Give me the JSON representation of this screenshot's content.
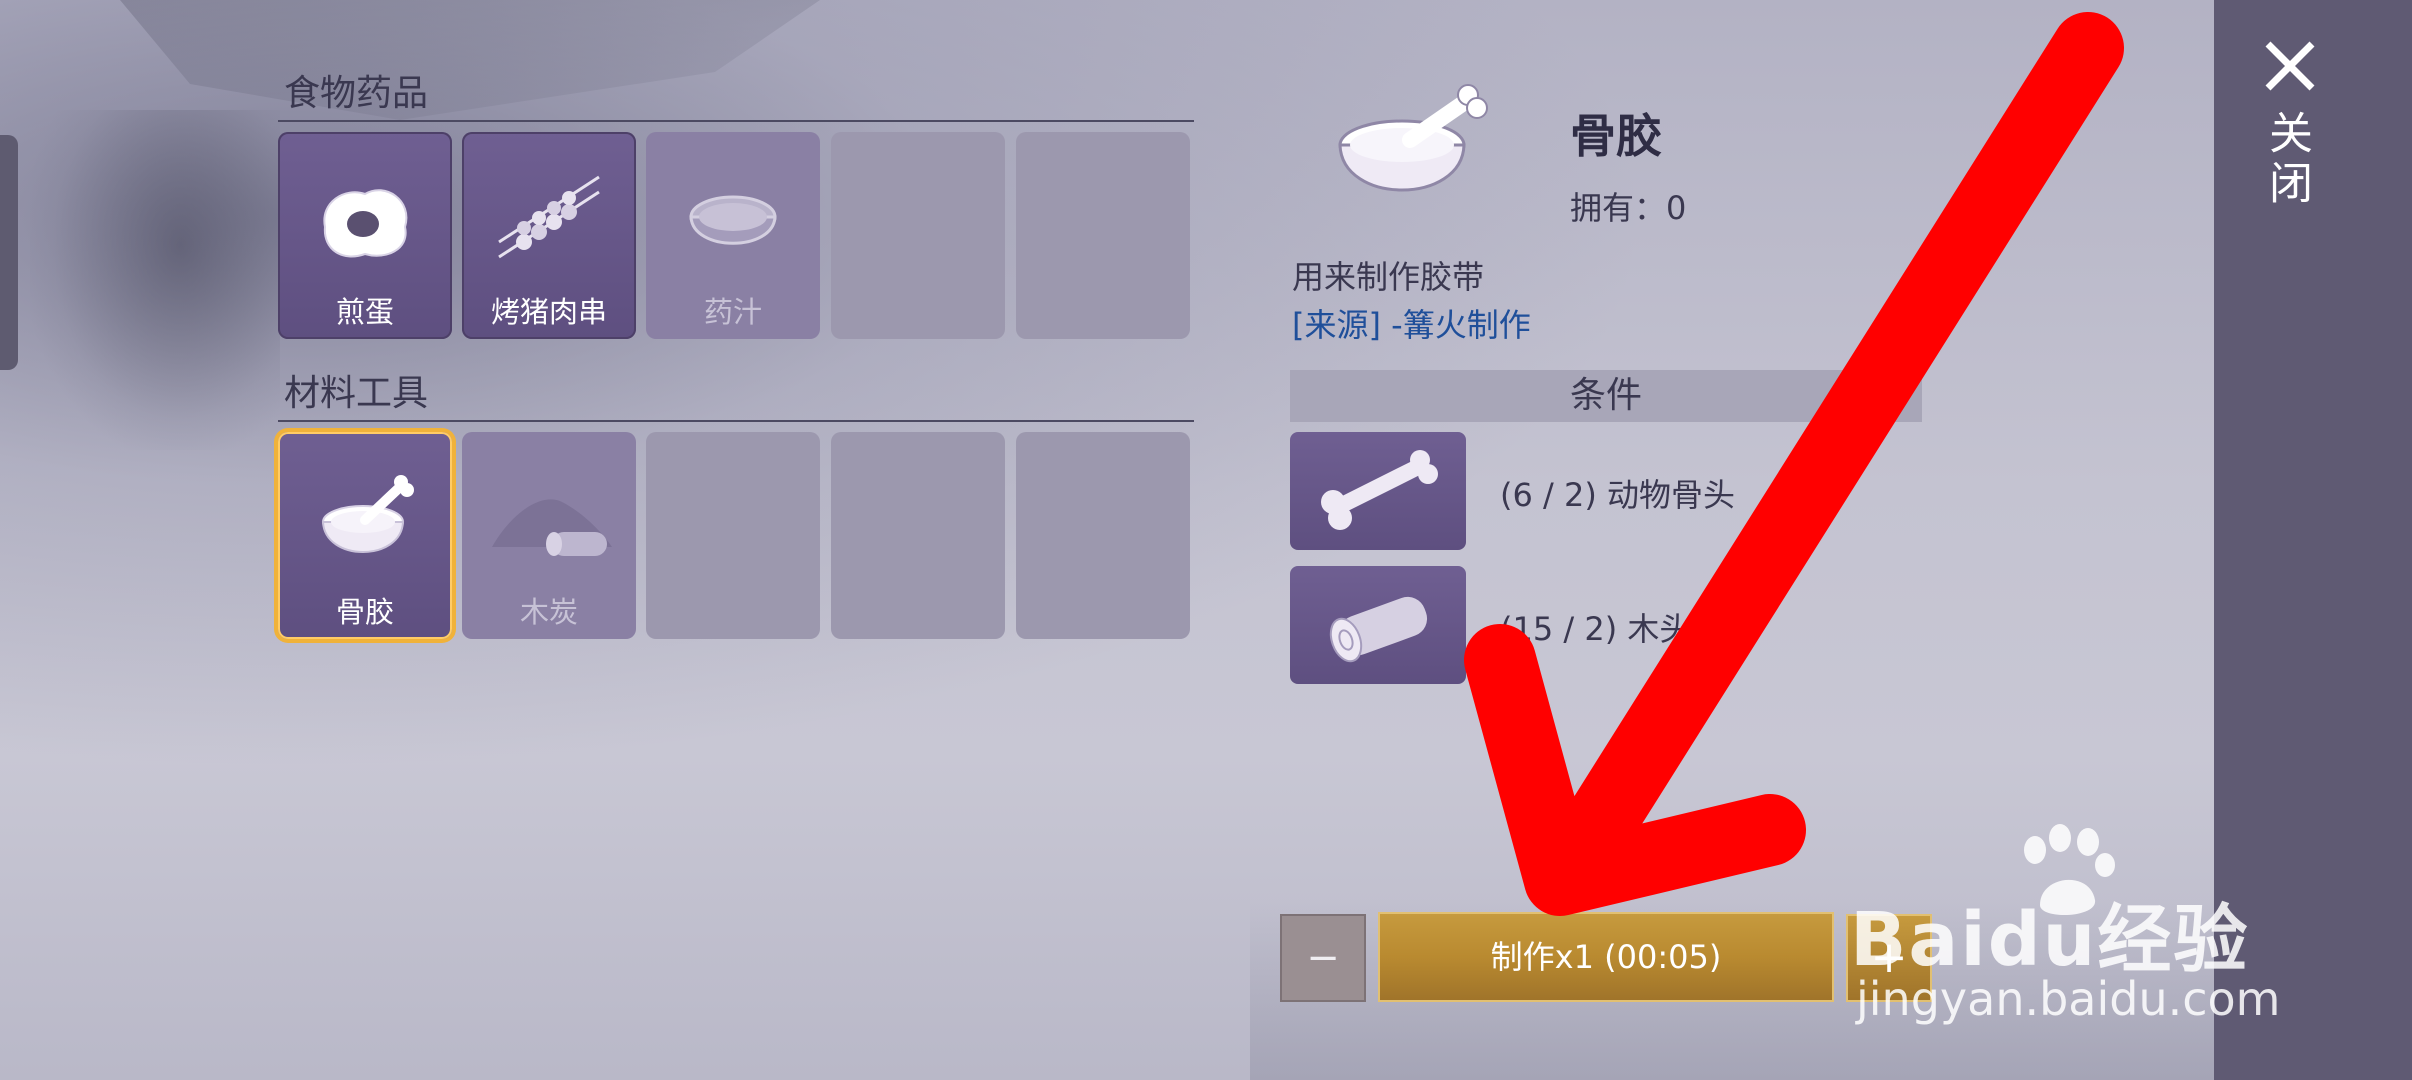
{
  "sections": {
    "food": {
      "title": "食物药品",
      "items": [
        {
          "label": "煎蛋",
          "icon": "fried-egg-icon",
          "state": "filled"
        },
        {
          "label": "烤猪肉串",
          "icon": "skewer-icon",
          "state": "filled"
        },
        {
          "label": "药汁",
          "icon": "potion-bowl-icon",
          "state": "faded"
        },
        {
          "label": "",
          "state": "empty"
        },
        {
          "label": "",
          "state": "empty"
        }
      ]
    },
    "materials": {
      "title": "材料工具",
      "items": [
        {
          "label": "骨胶",
          "icon": "bone-glue-bowl-icon",
          "state": "selected"
        },
        {
          "label": "木炭",
          "icon": "charcoal-icon",
          "state": "faded"
        },
        {
          "label": "",
          "state": "empty"
        },
        {
          "label": "",
          "state": "empty"
        },
        {
          "label": "",
          "state": "empty"
        }
      ]
    }
  },
  "detail": {
    "name": "骨胶",
    "owned": "拥有：0",
    "description": "用来制作胶带",
    "source": "[来源] -篝火制作",
    "conditions_title": "条件",
    "requirements": [
      {
        "text": "(6 / 2) 动物骨头",
        "icon": "bone-icon"
      },
      {
        "text": "(15 / 2) 木头",
        "icon": "log-icon"
      }
    ]
  },
  "craft": {
    "minus": "−",
    "button": "制作x1 (00:05)",
    "plus": "+"
  },
  "close": {
    "label": "关闭",
    "icon": "close-icon"
  },
  "watermark": {
    "logo": "Baidu经验",
    "url": "jingyan.baidu.com"
  },
  "colors": {
    "accent_gold": "#b98a30",
    "slot_purple": "#6f5f92",
    "selected_border": "#f0b23a",
    "source_link": "#1f4f9a",
    "annotation_red": "#ff0000"
  }
}
